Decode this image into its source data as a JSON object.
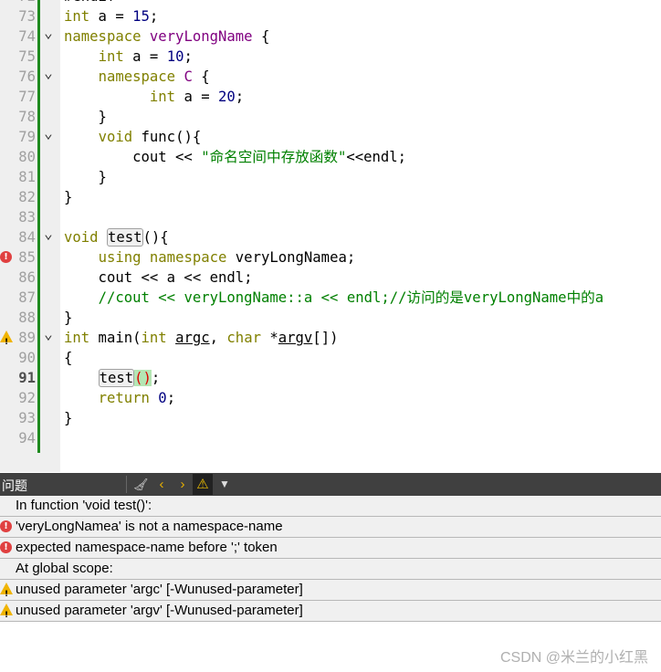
{
  "editor": {
    "current_line": 91,
    "lines": [
      {
        "n": 72,
        "t": [
          [
            "#endif",
            ""
          ]
        ]
      },
      {
        "n": 73,
        "t": [
          [
            "int",
            "kw"
          ],
          [
            " a = ",
            ""
          ],
          [
            "15",
            "n"
          ],
          [
            ";",
            ""
          ]
        ]
      },
      {
        "n": 74,
        "fold": true,
        "t": [
          [
            "namespace",
            "kw"
          ],
          [
            " ",
            ""
          ],
          [
            "veryLongName",
            "ns"
          ],
          [
            " {",
            ""
          ]
        ]
      },
      {
        "n": 75,
        "t": [
          [
            "    ",
            ""
          ],
          [
            "int",
            "kw"
          ],
          [
            " a = ",
            ""
          ],
          [
            "10",
            "n"
          ],
          [
            ";",
            ""
          ]
        ]
      },
      {
        "n": 76,
        "fold": true,
        "t": [
          [
            "    ",
            ""
          ],
          [
            "namespace",
            "kw"
          ],
          [
            " ",
            ""
          ],
          [
            "C",
            "ns"
          ],
          [
            " {",
            ""
          ]
        ]
      },
      {
        "n": 77,
        "t": [
          [
            "          ",
            ""
          ],
          [
            "int",
            "kw"
          ],
          [
            " a = ",
            ""
          ],
          [
            "20",
            "n"
          ],
          [
            ";",
            ""
          ]
        ]
      },
      {
        "n": 78,
        "t": [
          [
            "    }",
            ""
          ]
        ]
      },
      {
        "n": 79,
        "fold": true,
        "t": [
          [
            "    ",
            ""
          ],
          [
            "void",
            "kw"
          ],
          [
            " func(){",
            ""
          ]
        ]
      },
      {
        "n": 80,
        "t": [
          [
            "        cout << ",
            ""
          ],
          [
            "\"命名空间中存放函数\"",
            "s"
          ],
          [
            "<<endl;",
            ""
          ]
        ]
      },
      {
        "n": 81,
        "t": [
          [
            "    }",
            ""
          ]
        ]
      },
      {
        "n": 82,
        "t": [
          [
            "}",
            ""
          ]
        ]
      },
      {
        "n": 83,
        "t": []
      },
      {
        "n": 84,
        "fold": true,
        "t": [
          [
            "void",
            "kw"
          ],
          [
            " ",
            ""
          ],
          [
            "test",
            "box"
          ],
          [
            "(){",
            ""
          ]
        ]
      },
      {
        "n": 85,
        "mark": "error",
        "t": [
          [
            "    ",
            ""
          ],
          [
            "using",
            "kw"
          ],
          [
            " ",
            ""
          ],
          [
            "namespace",
            "kw"
          ],
          [
            " veryLongNamea;",
            ""
          ]
        ]
      },
      {
        "n": 86,
        "t": [
          [
            "    cout << a << endl;",
            ""
          ]
        ]
      },
      {
        "n": 87,
        "t": [
          [
            "    ",
            ""
          ],
          [
            "//cout << veryLongName::a << endl;//访问的是veryLongName中的a",
            "c"
          ]
        ]
      },
      {
        "n": 88,
        "t": [
          [
            "}",
            ""
          ]
        ]
      },
      {
        "n": 89,
        "fold": true,
        "mark": "warning",
        "t": [
          [
            "int",
            "kw"
          ],
          [
            " main(",
            ""
          ],
          [
            "int",
            "kw"
          ],
          [
            " ",
            ""
          ],
          [
            "argc",
            "u"
          ],
          [
            ", ",
            ""
          ],
          [
            "char",
            "kw"
          ],
          [
            " *",
            ""
          ],
          [
            "argv",
            "u"
          ],
          [
            "[])",
            ""
          ]
        ]
      },
      {
        "n": 90,
        "t": [
          [
            "{",
            ""
          ]
        ]
      },
      {
        "n": 91,
        "t": [
          [
            "    ",
            ""
          ],
          [
            "test",
            "box"
          ],
          [
            "()",
            "paren"
          ],
          [
            ";",
            ""
          ]
        ]
      },
      {
        "n": 92,
        "t": [
          [
            "    ",
            ""
          ],
          [
            "return",
            "kw"
          ],
          [
            " ",
            ""
          ],
          [
            "0",
            "n"
          ],
          [
            ";",
            ""
          ]
        ]
      },
      {
        "n": 93,
        "t": [
          [
            "}",
            ""
          ]
        ]
      },
      {
        "n": 94,
        "t": []
      }
    ]
  },
  "issues": {
    "title": "问题",
    "toolbar": [
      "clean-icon",
      "prev-icon",
      "next-icon",
      "warning-filter-icon",
      "filter-icon"
    ],
    "rows": [
      {
        "type": "none",
        "text": "In function 'void test()':"
      },
      {
        "type": "error",
        "text": "'veryLongNamea' is not a namespace-name"
      },
      {
        "type": "error",
        "text": "expected namespace-name before ';' token"
      },
      {
        "type": "none",
        "text": "At global scope:"
      },
      {
        "type": "warning",
        "text": "unused parameter 'argc' [-Wunused-parameter]"
      },
      {
        "type": "warning",
        "text": "unused parameter 'argv' [-Wunused-parameter]"
      }
    ]
  },
  "watermark": "CSDN @米兰的小红黑",
  "colors": {
    "keyword": "#808000",
    "namespace": "#800080",
    "number": "#000080",
    "string": "#008000",
    "error": "#e04040",
    "warning": "#f0b400"
  }
}
